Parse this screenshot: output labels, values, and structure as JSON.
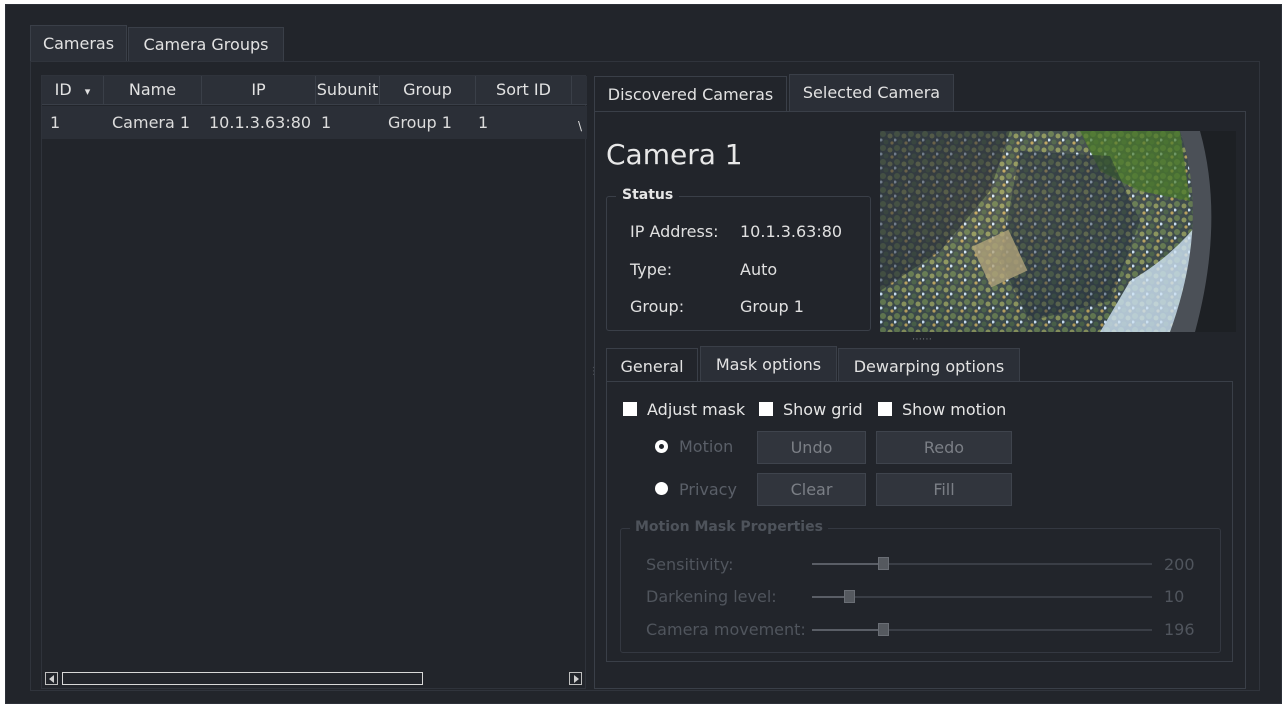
{
  "main_tabs": [
    {
      "label": "Cameras",
      "active": true
    },
    {
      "label": "Camera Groups",
      "active": false
    }
  ],
  "table": {
    "columns": [
      "ID",
      "Name",
      "IP",
      "Subunit",
      "Group",
      "Sort ID"
    ],
    "sort_indicator": "▾",
    "rows": [
      {
        "id": "1",
        "name": "Camera 1",
        "ip": "10.1.3.63:80",
        "subunit": "1",
        "group": "Group 1",
        "sort_id": "1",
        "extra": "\\"
      }
    ]
  },
  "detail_tabs": [
    {
      "label": "Discovered Cameras",
      "active": false
    },
    {
      "label": "Selected Camera",
      "active": true
    }
  ],
  "camera": {
    "title": "Camera 1",
    "status_legend": "Status",
    "fields": [
      {
        "label": "IP Address:",
        "value": "10.1.3.63:80"
      },
      {
        "label": "Type:",
        "value": "Auto"
      },
      {
        "label": "Group:",
        "value": "Group 1"
      }
    ]
  },
  "sub_tabs": [
    {
      "label": "General",
      "active": false
    },
    {
      "label": "Mask options",
      "active": true
    },
    {
      "label": "Dewarping options",
      "active": false
    }
  ],
  "mask_options": {
    "checkboxes": [
      {
        "label": "Adjust mask",
        "checked": false
      },
      {
        "label": "Show grid",
        "checked": false
      },
      {
        "label": "Show motion",
        "checked": false
      }
    ],
    "radios": [
      {
        "label": "Motion",
        "checked": true
      },
      {
        "label": "Privacy",
        "checked": false
      }
    ],
    "buttons": {
      "undo": "Undo",
      "redo": "Redo",
      "clear": "Clear",
      "fill": "Fill"
    },
    "properties_legend": "Motion Mask Properties",
    "sliders": [
      {
        "label": "Sensitivity:",
        "value": "200",
        "fraction": 0.21
      },
      {
        "label": "Darkening level:",
        "value": "10",
        "fraction": 0.11
      },
      {
        "label": "Camera movement:",
        "value": "196",
        "fraction": 0.21
      }
    ]
  },
  "colors": {
    "background": "#22252b",
    "tab_active": "#2b2f37",
    "border": "#3a3f48",
    "text": "#e2e2e2",
    "disabled_text": "#5a5f68"
  }
}
